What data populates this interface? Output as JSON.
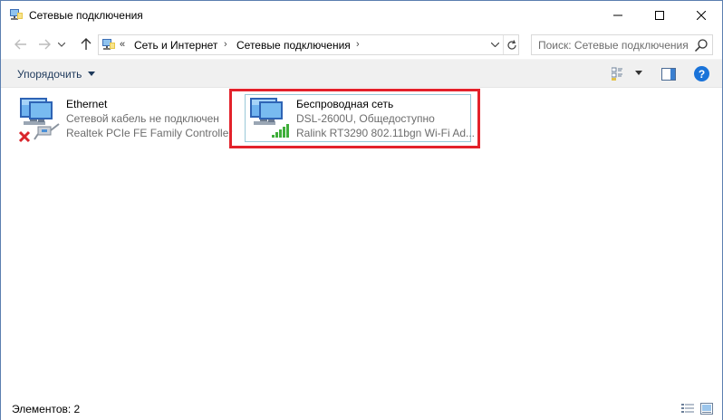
{
  "window": {
    "title": "Сетевые подключения"
  },
  "address": {
    "overflow": "«",
    "crumbs": [
      "Сеть и Интернет",
      "Сетевые подключения"
    ]
  },
  "search": {
    "placeholder": "Поиск: Сетевые подключения"
  },
  "toolbar": {
    "organize_label": "Упорядочить"
  },
  "connections": [
    {
      "name": "Ethernet",
      "status": "Сетевой кабель не подключен",
      "adapter": "Realtek PCIe FE Family Controller",
      "icon": "ethernet-disconnected-icon"
    },
    {
      "name": "Беспроводная сеть",
      "status": "DSL-2600U, Общедоступно",
      "adapter": "Ralink RT3290 802.11bgn Wi-Fi Ad...",
      "icon": "wireless-network-icon"
    }
  ],
  "status": {
    "items_count": "Элементов: 2"
  },
  "colors": {
    "highlight": "#e3222b",
    "selection_border": "#99c9d9",
    "help": "#1a73d9",
    "signal": "#3fae3a"
  }
}
